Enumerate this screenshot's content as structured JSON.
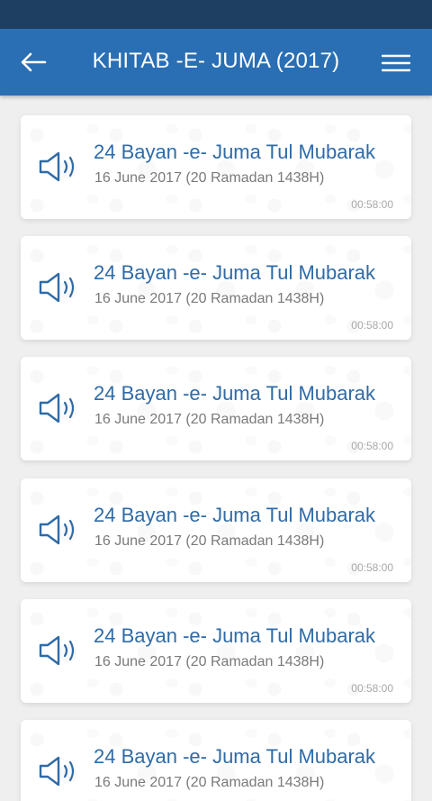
{
  "header": {
    "title": "KHITAB -E- JUMA (2017)"
  },
  "items": [
    {
      "title": "24 Bayan -e- Juma Tul Mubarak",
      "subtitle": "16 June 2017 (20 Ramadan 1438H)",
      "duration": "00:58:00"
    },
    {
      "title": "24 Bayan -e- Juma Tul Mubarak",
      "subtitle": "16 June 2017 (20 Ramadan 1438H)",
      "duration": "00:58:00"
    },
    {
      "title": "24 Bayan -e- Juma Tul Mubarak",
      "subtitle": "16 June 2017 (20 Ramadan 1438H)",
      "duration": "00:58:00"
    },
    {
      "title": "24 Bayan -e- Juma Tul Mubarak",
      "subtitle": "16 June 2017 (20 Ramadan 1438H)",
      "duration": "00:58:00"
    },
    {
      "title": "24 Bayan -e- Juma Tul Mubarak",
      "subtitle": "16 June 2017 (20 Ramadan 1438H)",
      "duration": "00:58:00"
    },
    {
      "title": "24 Bayan -e- Juma Tul Mubarak",
      "subtitle": "16 June 2017 (20 Ramadan 1438H)",
      "duration": ""
    }
  ],
  "icons": {
    "back": "back-arrow-icon",
    "menu": "hamburger-menu-icon",
    "item": "speaker-icon"
  },
  "colors": {
    "status_bar": "#1e3f61",
    "app_bar": "#2a6fb4",
    "title_text": "#2f6ba8",
    "background": "#efefef"
  }
}
